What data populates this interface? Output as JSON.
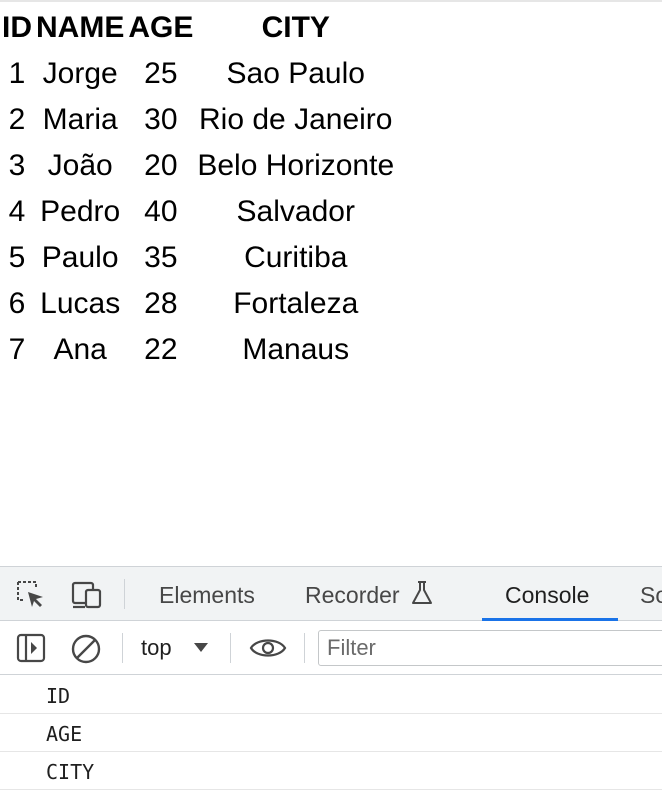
{
  "table": {
    "headers": [
      "ID",
      "NAME",
      "AGE",
      "CITY"
    ],
    "rows": [
      [
        "1",
        "Jorge",
        "25",
        "Sao Paulo"
      ],
      [
        "2",
        "Maria",
        "30",
        "Rio de Janeiro"
      ],
      [
        "3",
        "João",
        "20",
        "Belo Horizonte"
      ],
      [
        "4",
        "Pedro",
        "40",
        "Salvador"
      ],
      [
        "5",
        "Paulo",
        "35",
        "Curitiba"
      ],
      [
        "6",
        "Lucas",
        "28",
        "Fortaleza"
      ],
      [
        "7",
        "Ana",
        "22",
        "Manaus"
      ]
    ]
  },
  "devtools": {
    "icons": [
      "inspect-element-icon",
      "device-toolbar-icon",
      "flask-icon",
      "sidebar-toggle-icon",
      "clear-console-icon",
      "eye-icon"
    ],
    "tabs": {
      "elements": "Elements",
      "recorder": "Recorder",
      "console": "Console",
      "sources_partial": "So"
    },
    "active_tab": "Console",
    "accent_color": "#1a73e8",
    "toolbar": {
      "context": "top",
      "filter_placeholder": "Filter"
    },
    "console_output": [
      "ID",
      "AGE",
      "CITY"
    ]
  }
}
